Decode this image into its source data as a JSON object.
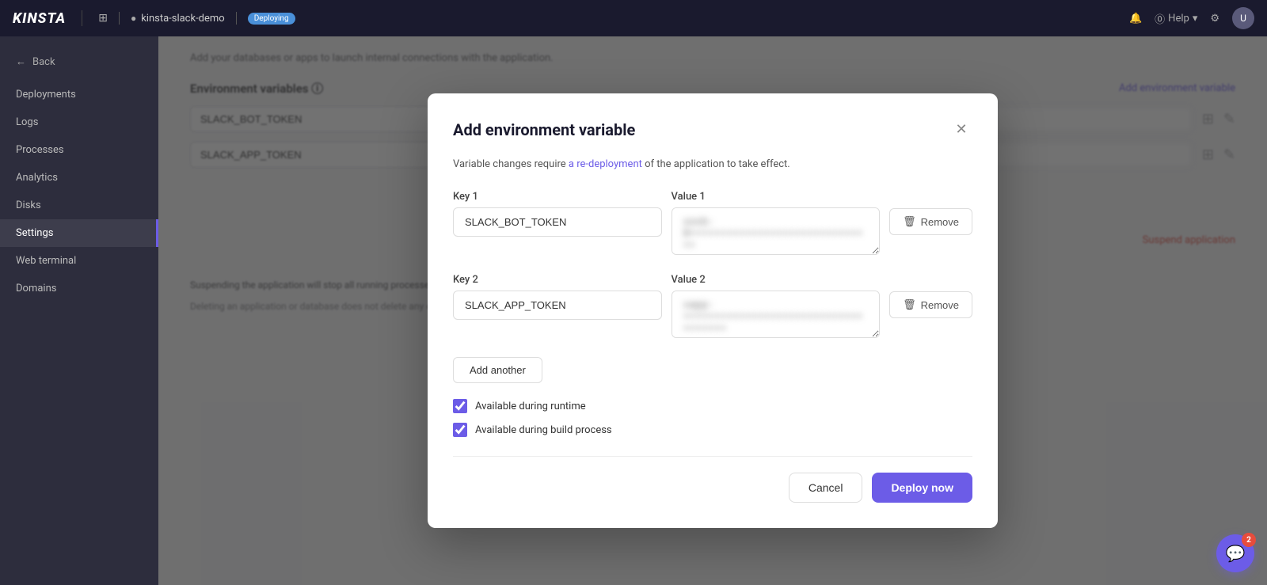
{
  "nav": {
    "logo": "KINSTA",
    "app_icon": "⊞",
    "app_name": "kinsta-slack-demo",
    "status": "Deploying",
    "bell_label": "🔔",
    "help_label": "Help",
    "settings_icon": "⚙",
    "avatar_initials": "U"
  },
  "sidebar": {
    "back_label": "Back",
    "items": [
      {
        "id": "deployments",
        "label": "Deployments",
        "active": false
      },
      {
        "id": "logs",
        "label": "Logs",
        "active": false
      },
      {
        "id": "processes",
        "label": "Processes",
        "active": false
      },
      {
        "id": "analytics",
        "label": "Analytics",
        "active": false
      },
      {
        "id": "disks",
        "label": "Disks",
        "active": false
      },
      {
        "id": "settings",
        "label": "Settings",
        "active": true
      },
      {
        "id": "web-terminal",
        "label": "Web terminal",
        "active": false
      },
      {
        "id": "domains",
        "label": "Domains",
        "active": false
      }
    ]
  },
  "content": {
    "top_text": "Add your databases or apps to launch internal connections with the application.",
    "env_section_title": "Environment variables ⓘ",
    "add_variable_link": "Add environment variable",
    "suspend_link": "Suspend application",
    "bottom_text_1": "Suspending the application will stop all running processes and make the application unavailable. You can resume the application at any time by clicking the Resume button.",
    "bottom_text_2": "Deleting an application or database does not delete any existing WordPress hosting plans. You must cancel them separately."
  },
  "modal": {
    "title": "Add environment variable",
    "notice": "Variable changes require a re-deployment of the application to take effect.",
    "notice_link_text": "a re-deployment",
    "key1_label": "Key 1",
    "key1_value": "SLACK_BOT_TOKEN",
    "value1_label": "Value 1",
    "value1_placeholder": "xoxb-0••••••••••••••••••••••",
    "key2_label": "Key 2",
    "key2_value": "SLACK_APP_TOKEN",
    "value2_label": "Value 2",
    "value2_placeholder": "xapp-••••••••••••••••••••••••••••••",
    "add_another_label": "Add another",
    "checkbox1_label": "Available during runtime",
    "checkbox2_label": "Available during build process",
    "remove_label": "Remove",
    "cancel_label": "Cancel",
    "deploy_label": "Deploy now"
  },
  "chat": {
    "badge_count": "2"
  }
}
